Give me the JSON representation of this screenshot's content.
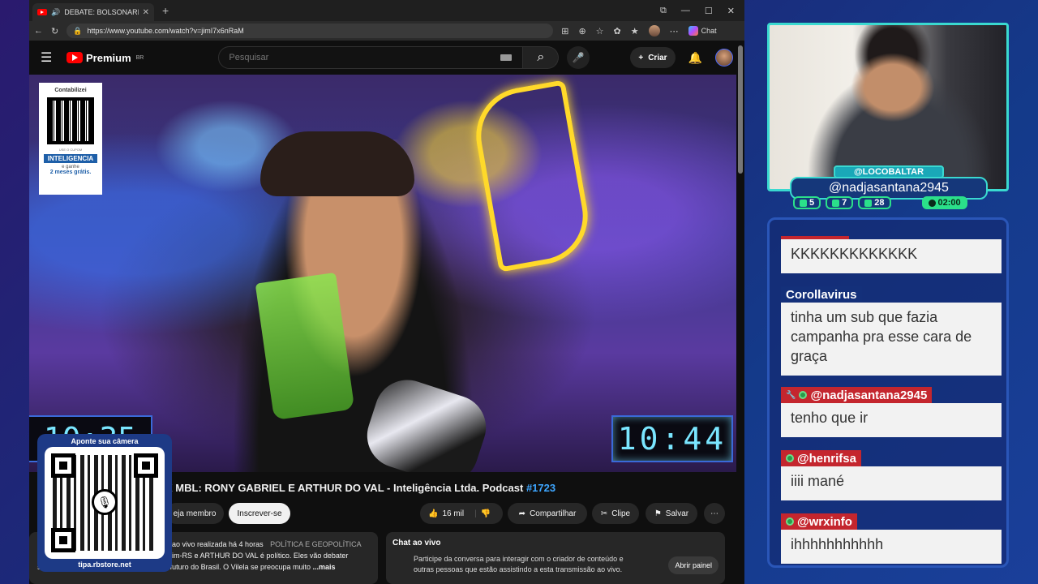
{
  "browser": {
    "tab_title": "DEBATE: BOLSONARISTA X MBL",
    "url": "https://www.youtube.com/watch?v=jimI7x6nRaM",
    "chat_label": "Chat"
  },
  "youtube": {
    "logo_text": "Premium",
    "region": "BR",
    "search_placeholder": "Pesquisar",
    "create_label": "Criar"
  },
  "video": {
    "promo_brand_top": "Contabilizei",
    "promo_small": "USE O CUPOM",
    "promo_brand": "INTELIGENCIA",
    "promo_gift_line1": "e ganhe",
    "promo_gift_line2": "2 meses grátis.",
    "clock_right": "10:44",
    "clock_left": "10:35",
    "title_main": "X MBL: RONY GABRIEL E ARTHUR DO VAL - Inteligência Ltda. Podcast",
    "title_episode": "#1723"
  },
  "actions": {
    "member": "eja membro",
    "subscribe": "Inscrever-se",
    "likes": "16 mil",
    "share": "Compartilhar",
    "clip": "Clipe",
    "save": "Salvar"
  },
  "description": {
    "line1_main": "ao vivo realizada há 4 horas",
    "line1_cat": "POLÍTICA E GEOPOLÍTICA",
    "line2": "im-RS e ARTHUR DO VAL é político. Eles vão debater",
    "line3": "sobre Bolsonaro, a política da direita e o futuro do Brasil. O Vilela se preocupa muito",
    "more": "...mais"
  },
  "livechat": {
    "title": "Chat ao vivo",
    "text": "Participe da conversa para interagir com o criador de conteúdo e outras pessoas que estão assistindo a esta transmissão ao vivo.",
    "open": "Abrir painel"
  },
  "qr_overlay": {
    "label": "Aponte sua câmera",
    "footer": "tipa.rbstore.net"
  },
  "nameplate": {
    "channel": "@LOCOBALTAR",
    "user": "@nadjasantana2945",
    "stats": [
      "5",
      "7",
      "28"
    ],
    "timer": "02:00"
  },
  "chat": [
    {
      "user": "",
      "text": "KKKKKKKKKKKKK"
    },
    {
      "user": "Corollavirus",
      "text": "tinha um sub que fazia campanha pra esse cara de graça"
    },
    {
      "user": "@nadjasantana2945",
      "text": "tenho que ir"
    },
    {
      "user": "@henrifsa",
      "text": "iiii mané"
    },
    {
      "user": "@wrxinfo",
      "text": "ihhhhhhhhhhh"
    }
  ],
  "colors": {
    "accent": "#3ad9d0",
    "chat_red": "#c4262e",
    "chat_blue": "#14307a",
    "yt_red": "#ff0000"
  }
}
